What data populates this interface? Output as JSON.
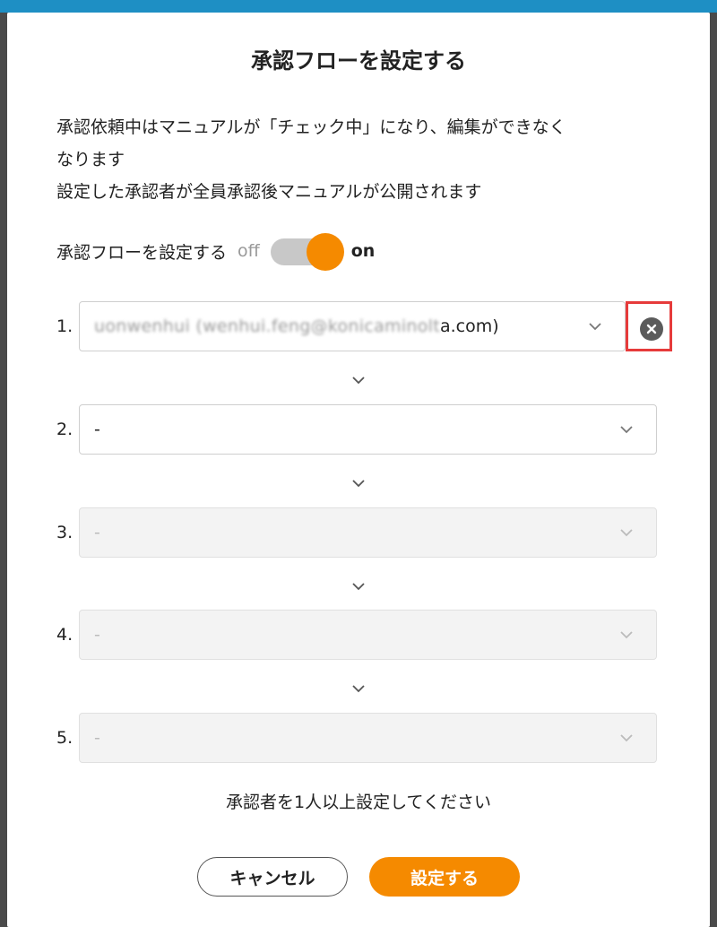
{
  "dialog": {
    "title": "承認フローを設定する",
    "description_line1": "承認依頼中はマニュアルが「チェック中」になり、編集ができなく",
    "description_line2": "なります",
    "description_line3": "設定した承認者が全員承認後マニュアルが公開されます"
  },
  "toggle": {
    "label": "承認フローを設定する",
    "off_label": "off",
    "on_label": "on",
    "state": "on"
  },
  "steps": [
    {
      "number": "1.",
      "value_obscured": "uonwenhui (wenhui.feng@konicaminolt",
      "value_visible": "a.com)",
      "disabled": false
    },
    {
      "number": "2.",
      "value": "-",
      "disabled": false
    },
    {
      "number": "3.",
      "value": "-",
      "disabled": true
    },
    {
      "number": "4.",
      "value": "-",
      "disabled": true
    },
    {
      "number": "5.",
      "value": "-",
      "disabled": true
    }
  ],
  "hint": "承認者を1人以上設定してください",
  "buttons": {
    "cancel": "キャンセル",
    "submit": "設定する"
  },
  "colors": {
    "accent": "#f58a00",
    "highlight": "#e63b3b",
    "top_bar": "#1e8fc4"
  },
  "icons": [
    "chevron-down-icon",
    "close-circle-icon"
  ]
}
